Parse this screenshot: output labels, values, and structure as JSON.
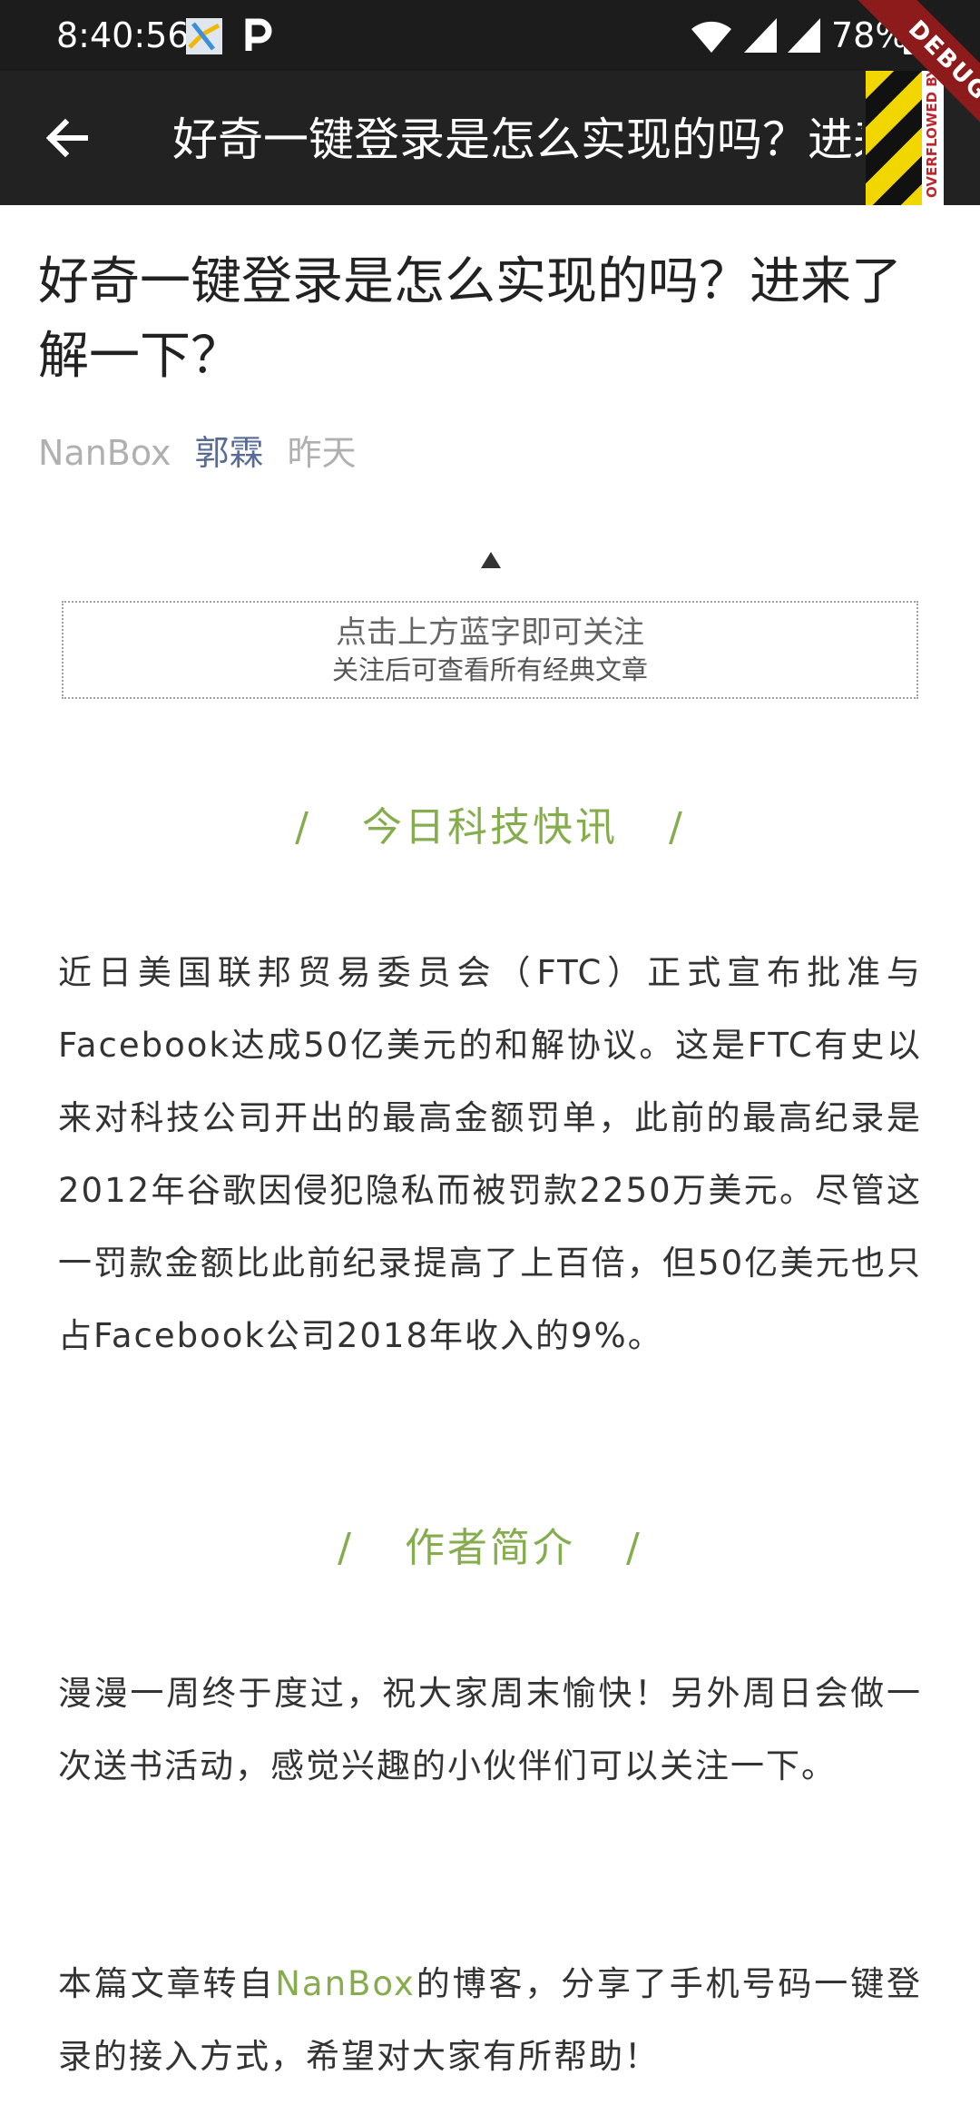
{
  "status_bar": {
    "time": "8:40:56",
    "battery": "78%",
    "icons": [
      "map-app-icon",
      "p-app-icon",
      "wifi-icon",
      "signal-icon",
      "signal-icon",
      "battery-icon"
    ]
  },
  "app_bar": {
    "back_icon": "arrow-back-icon",
    "title": "好奇一键登录是怎么实现的吗？进来了解一下？",
    "debug_banner": "DEBUG",
    "overflow_label": "OVERFLOWED BY"
  },
  "article": {
    "title": "好奇一键登录是怎么实现的吗？进来了解一下？",
    "meta": {
      "source": "NanBox",
      "author": "郭霖",
      "date": "昨天"
    },
    "follow_box": {
      "line1": "点击上方蓝字即可关注",
      "line2": "关注后可查看所有经典文章"
    },
    "sections": [
      {
        "heading": "今日科技快讯",
        "slash": "/",
        "paragraph": "近日美国联邦贸易委员会（FTC）正式宣布批准与Facebook达成50亿美元的和解协议。这是FTC有史以来对科技公司开出的最高金额罚单，此前的最高纪录是2012年谷歌因侵犯隐私而被罚款2250万美元。尽管这一罚款金额比此前纪录提高了上百倍，但50亿美元也只占Facebook公司2018年收入的9%。"
      },
      {
        "heading": "作者简介",
        "slash": "/",
        "paragraph": "漫漫一周终于度过，祝大家周末愉快！另外周日会做一次送书活动，感觉兴趣的小伙伴们可以关注一下。"
      }
    ],
    "repost": {
      "before": "本篇文章转自",
      "link": "NanBox",
      "after": "的博客，分享了手机号码一键登录的接入方式，希望对大家有所帮助！"
    }
  },
  "colors": {
    "accent_green": "#86ad4d",
    "author_blue": "#576b95",
    "status_bar": "#1c1c1c",
    "app_bar": "#222222"
  }
}
